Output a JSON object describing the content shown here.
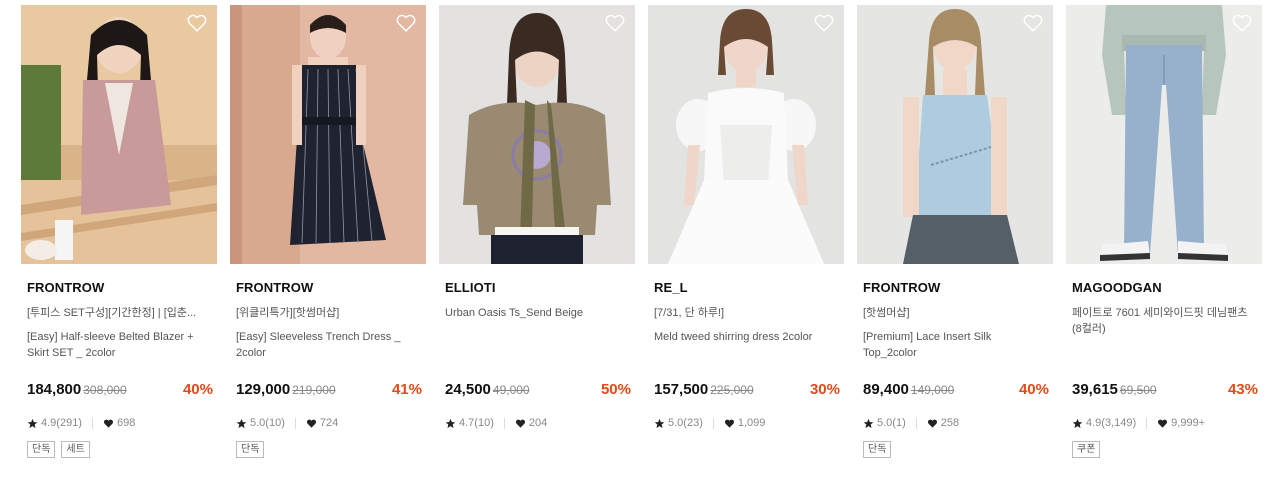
{
  "products": [
    {
      "brand": "FRONTROW",
      "promo": "[투피스 SET구성][기간한정] | [입춘...",
      "name": "[Easy] Half-sleeve Belted Blazer + Skirt SET _ 2color",
      "price": "184,800",
      "original_price": "308,000",
      "discount": "40%",
      "rating": "4.9(291)",
      "likes": "698",
      "tags": [
        "단독",
        "세트"
      ]
    },
    {
      "brand": "FRONTROW",
      "promo": "[위클리특가][핫썸머샵]",
      "name": "[Easy] Sleeveless Trench Dress _ 2color",
      "price": "129,000",
      "original_price": "219,000",
      "discount": "41%",
      "rating": "5.0(10)",
      "likes": "724",
      "tags": [
        "단독"
      ]
    },
    {
      "brand": "ELLIOTI",
      "promo": "",
      "name": "Urban Oasis Ts_Send Beige",
      "price": "24,500",
      "original_price": "49,000",
      "discount": "50%",
      "rating": "4.7(10)",
      "likes": "204",
      "tags": []
    },
    {
      "brand": "RE_L",
      "promo": "[7/31, 단 하루!]",
      "name": "Meld tweed shirring dress 2color",
      "price": "157,500",
      "original_price": "225,000",
      "discount": "30%",
      "rating": "5.0(23)",
      "likes": "1,099",
      "tags": []
    },
    {
      "brand": "FRONTROW",
      "promo": "[핫썸머샵]",
      "name": "[Premium] Lace Insert Silk Top_2color",
      "price": "89,400",
      "original_price": "149,000",
      "discount": "40%",
      "rating": "5.0(1)",
      "likes": "258",
      "tags": [
        "단독"
      ]
    },
    {
      "brand": "MAGOODGAN",
      "promo": "",
      "name": "페이트로 7601 세미와이드핏 데님팬츠 (8컬러)",
      "price": "39,615",
      "original_price": "69,500",
      "discount": "43%",
      "rating": "4.9(3,149)",
      "likes": "9,999+",
      "tags": [
        "쿠폰"
      ]
    }
  ],
  "colors": {
    "discount": "#e24a1a",
    "text_primary": "#111111",
    "text_secondary": "#555555",
    "text_muted": "#888888"
  },
  "icons": {
    "wishlist": "heart-outline-icon",
    "rating": "star-icon",
    "likes": "heart-filled-icon"
  }
}
